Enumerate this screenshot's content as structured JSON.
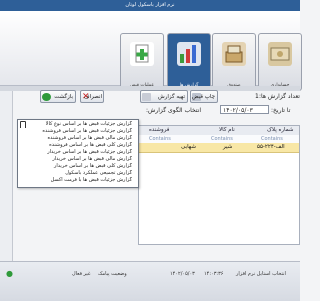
{
  "window": {
    "title": "نرم افزار باسکول لوتان"
  },
  "ribbon": {
    "buttons": [
      {
        "label": "حسابداری",
        "icon": "money-icon"
      },
      {
        "label": "صندوق",
        "icon": "cash-box-icon"
      },
      {
        "label": "گزارش ها",
        "icon": "chart-icon"
      },
      {
        "label": "عملیات قبض",
        "icon": "add-document-icon"
      }
    ]
  },
  "form": {
    "report_count_label": ":تعداد گزارش ها",
    "report_count_value": "1",
    "date_label": ":تا تاریخ",
    "date_value": "۱۴۰۲/۰۵/۰۳",
    "template_label": ":انتخاب الگوی گزارش",
    "template_value": "۱۴۰۲/۰۵/۰۳"
  },
  "toolbar": {
    "print_label": "چاپ قبض",
    "prepare_label": "تهیه گزارش",
    "cancel_label": "انصراف",
    "back_label": "بازگشت"
  },
  "grid": {
    "columns": [
      "شماره پلاک",
      "نام کالا",
      "فروشنده"
    ],
    "filter_placeholder": "Contains",
    "rows": [
      {
        "plate": "۵۵-الف-۲۲۴",
        "product": "شیر",
        "seller": "شهابی"
      }
    ]
  },
  "dropdown": {
    "items": [
      "گزارش جزئیات قبض ها بر اساس نوع کالا",
      "گزارش جزئیات قبض ها بر اساس فروشنده",
      "گزارش مالی قبض ها بر اساس فروشنده",
      "گزارش کلی قبض ها بر اساس فروشنده",
      "گزارش جزئیات قبض ها بر اساس خریدار",
      "گزارش مالی قبض ها بر اساس خریدار",
      "گزارش کلی قبض ها بر اساس خریدار",
      "گزارش تجمیعی عملکرد باسکول",
      "گزارش جزئیات قبض ها با فرمت اکسل"
    ]
  },
  "status": {
    "app_title": "انتخاب استایل نرم افزار",
    "time": "۱۴:۰۳:۳۶",
    "date": "۱۴۰۲/۰۵/۰۳",
    "sms_status": "وضعیت پیامک",
    "sms_value": "غیر فعال"
  },
  "colors": {
    "accent": "#2e5f98",
    "selected_row": "#f8e7a6"
  }
}
